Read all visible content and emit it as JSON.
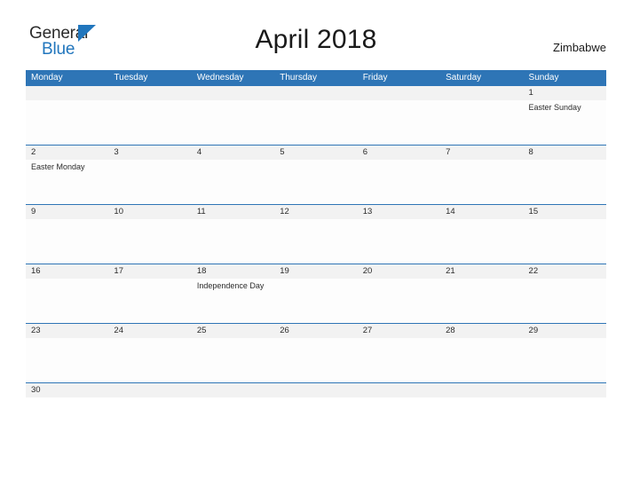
{
  "logo": {
    "word_one": "General",
    "word_two": "Blue",
    "triangle_color": "#2176bd",
    "text_color": "#2b2b2b"
  },
  "header": {
    "title": "April 2018",
    "country": "Zimbabwe"
  },
  "colors": {
    "header_blue": "#2e75b6",
    "daybar_gray": "#f2f2f2",
    "rule_blue": "#2e75b6"
  },
  "weekdays": [
    "Monday",
    "Tuesday",
    "Wednesday",
    "Thursday",
    "Friday",
    "Saturday",
    "Sunday"
  ],
  "weeks": [
    {
      "days": [
        {
          "num": "",
          "event": ""
        },
        {
          "num": "",
          "event": ""
        },
        {
          "num": "",
          "event": ""
        },
        {
          "num": "",
          "event": ""
        },
        {
          "num": "",
          "event": ""
        },
        {
          "num": "",
          "event": ""
        },
        {
          "num": "1",
          "event": "Easter Sunday"
        }
      ]
    },
    {
      "days": [
        {
          "num": "2",
          "event": "Easter Monday"
        },
        {
          "num": "3",
          "event": ""
        },
        {
          "num": "4",
          "event": ""
        },
        {
          "num": "5",
          "event": ""
        },
        {
          "num": "6",
          "event": ""
        },
        {
          "num": "7",
          "event": ""
        },
        {
          "num": "8",
          "event": ""
        }
      ]
    },
    {
      "days": [
        {
          "num": "9",
          "event": ""
        },
        {
          "num": "10",
          "event": ""
        },
        {
          "num": "11",
          "event": ""
        },
        {
          "num": "12",
          "event": ""
        },
        {
          "num": "13",
          "event": ""
        },
        {
          "num": "14",
          "event": ""
        },
        {
          "num": "15",
          "event": ""
        }
      ]
    },
    {
      "days": [
        {
          "num": "16",
          "event": ""
        },
        {
          "num": "17",
          "event": ""
        },
        {
          "num": "18",
          "event": "Independence Day"
        },
        {
          "num": "19",
          "event": ""
        },
        {
          "num": "20",
          "event": ""
        },
        {
          "num": "21",
          "event": ""
        },
        {
          "num": "22",
          "event": ""
        }
      ]
    },
    {
      "days": [
        {
          "num": "23",
          "event": ""
        },
        {
          "num": "24",
          "event": ""
        },
        {
          "num": "25",
          "event": ""
        },
        {
          "num": "26",
          "event": ""
        },
        {
          "num": "27",
          "event": ""
        },
        {
          "num": "28",
          "event": ""
        },
        {
          "num": "29",
          "event": ""
        }
      ]
    },
    {
      "days": [
        {
          "num": "30",
          "event": ""
        },
        {
          "num": "",
          "event": ""
        },
        {
          "num": "",
          "event": ""
        },
        {
          "num": "",
          "event": ""
        },
        {
          "num": "",
          "event": ""
        },
        {
          "num": "",
          "event": ""
        },
        {
          "num": "",
          "event": ""
        }
      ]
    }
  ]
}
